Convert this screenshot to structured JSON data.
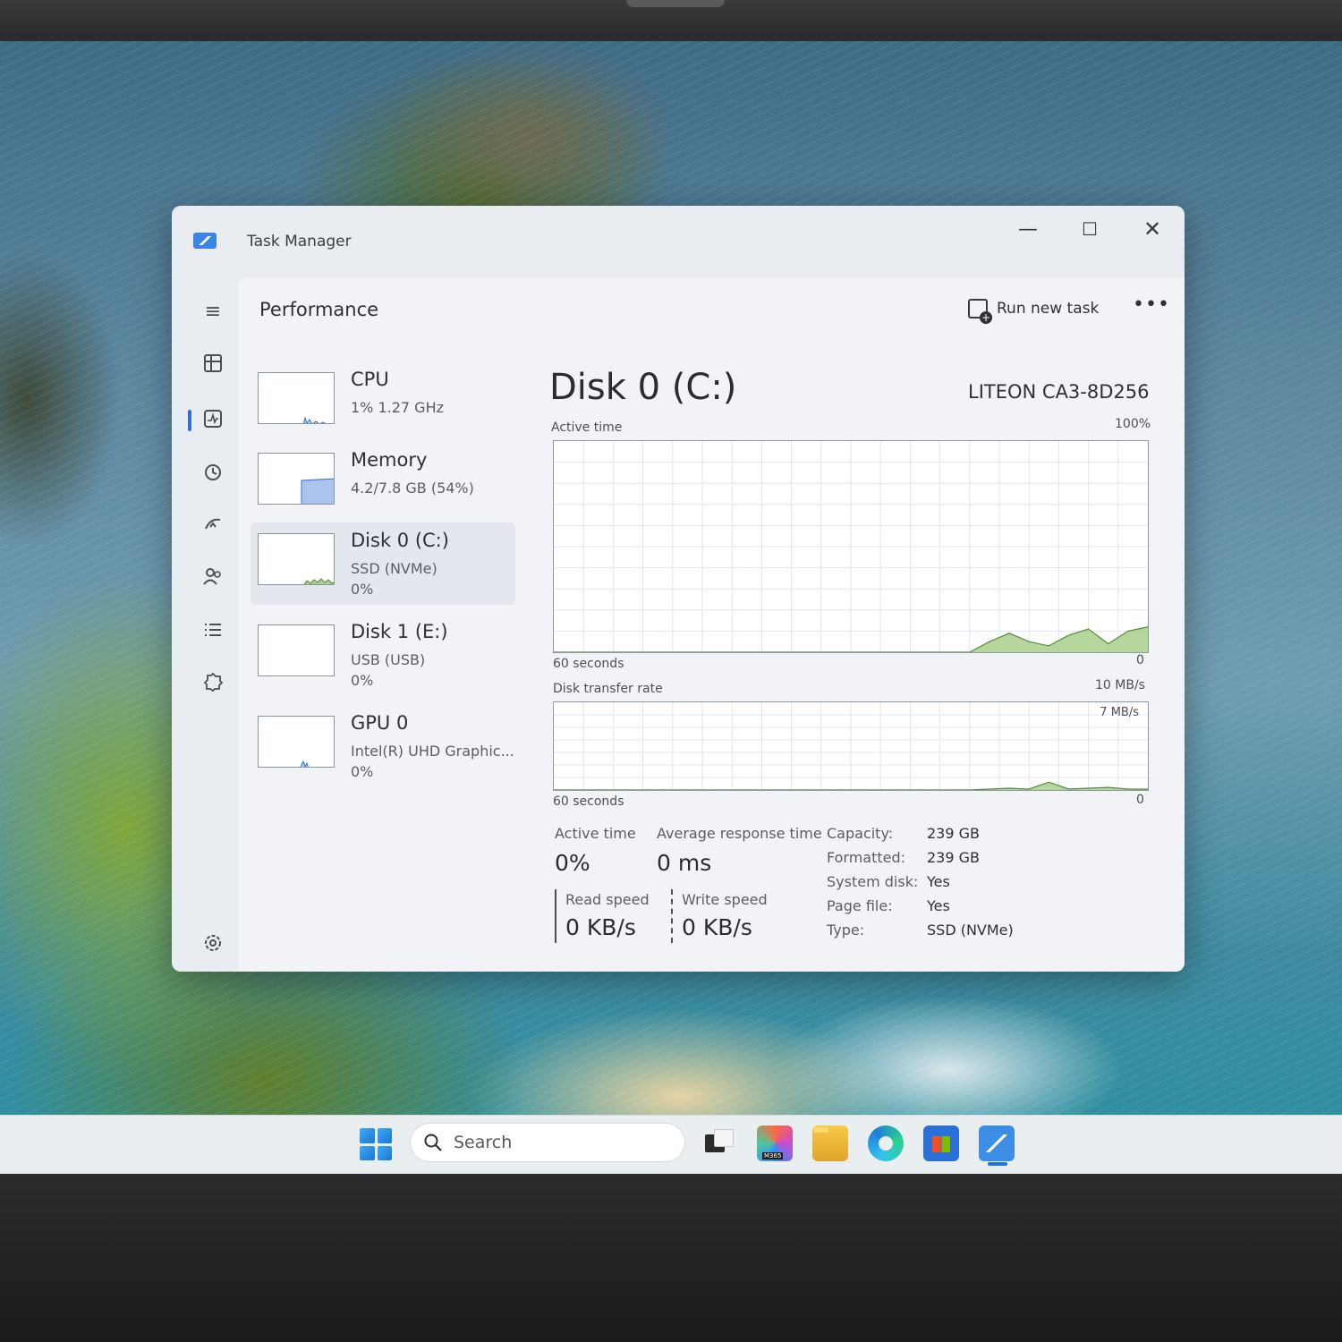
{
  "window": {
    "title": "Task Manager",
    "controls": {
      "minimize": "—",
      "maximize": "☐",
      "close": "✕"
    }
  },
  "page": {
    "title": "Performance",
    "run_new_task": "Run new task",
    "more": "•••"
  },
  "nav_icons": [
    "hamburger-icon",
    "processes-icon",
    "performance-icon",
    "app-history-icon",
    "startup-apps-icon",
    "users-icon",
    "details-icon",
    "services-icon",
    "settings-icon"
  ],
  "resources": [
    {
      "name": "CPU",
      "sub": "1% 1.27 GHz",
      "sub2": ""
    },
    {
      "name": "Memory",
      "sub": "4.2/7.8 GB (54%)",
      "sub2": ""
    },
    {
      "name": "Disk 0 (C:)",
      "sub": "SSD (NVMe)",
      "sub2": "0%"
    },
    {
      "name": "Disk 1 (E:)",
      "sub": "USB (USB)",
      "sub2": "0%"
    },
    {
      "name": "GPU 0",
      "sub": "Intel(R) UHD Graphic...",
      "sub2": "0%"
    }
  ],
  "detail": {
    "title": "Disk 0 (C:)",
    "model": "LITEON CA3-8D256",
    "active_time_graph": {
      "label": "Active time",
      "max": "100%",
      "time_span": "60 seconds",
      "min": "0"
    },
    "transfer_graph": {
      "label": "Disk transfer rate",
      "max": "10 MB/s",
      "inner_max": "7 MB/s",
      "time_span": "60 seconds",
      "min": "0"
    },
    "stats": {
      "active_time_label": "Active time",
      "active_time_value": "0%",
      "avg_response_label": "Average response time",
      "avg_response_value": "0 ms",
      "read_label": "Read speed",
      "read_value": "0 KB/s",
      "write_label": "Write speed",
      "write_value": "0 KB/s"
    },
    "properties": [
      {
        "label": "Capacity:",
        "value": "239 GB"
      },
      {
        "label": "Formatted:",
        "value": "239 GB"
      },
      {
        "label": "System disk:",
        "value": "Yes"
      },
      {
        "label": "Page file:",
        "value": "Yes"
      },
      {
        "label": "Type:",
        "value": "SSD (NVMe)"
      }
    ]
  },
  "chart_data": [
    {
      "type": "area",
      "title": "Active time",
      "ylim": [
        0,
        100
      ],
      "x": [
        60,
        58,
        56,
        54,
        52,
        50,
        48,
        46,
        44,
        42,
        40,
        38,
        36,
        34,
        32,
        30,
        28,
        26,
        24,
        22,
        20,
        18,
        16,
        14,
        12,
        10,
        8,
        6,
        4,
        2,
        0
      ],
      "series": [
        {
          "values": [
            0,
            0,
            0,
            0,
            0,
            0,
            0,
            0,
            0,
            0,
            0,
            0,
            0,
            0,
            0,
            0,
            0,
            0,
            0,
            0,
            0,
            0,
            5,
            9,
            5,
            3,
            8,
            11,
            4,
            10,
            12
          ]
        }
      ]
    },
    {
      "type": "area",
      "title": "Disk transfer rate",
      "ylim": [
        0,
        10
      ],
      "x": [
        60,
        58,
        56,
        54,
        52,
        50,
        48,
        46,
        44,
        42,
        40,
        38,
        36,
        34,
        32,
        30,
        28,
        26,
        24,
        22,
        20,
        18,
        16,
        14,
        12,
        10,
        8,
        6,
        4,
        2,
        0
      ],
      "series": [
        {
          "values": [
            0,
            0,
            0,
            0,
            0,
            0,
            0,
            0,
            0,
            0,
            0,
            0,
            0,
            0,
            0,
            0,
            0,
            0,
            0,
            0,
            0,
            0,
            0.1,
            0.2,
            0.1,
            0.9,
            0.1,
            0.2,
            0.3,
            0.1,
            0.1
          ]
        }
      ]
    }
  ],
  "taskbar": {
    "search_placeholder": "Search",
    "apps": [
      "start-icon",
      "task-view-icon",
      "microsoft-365-icon",
      "file-explorer-icon",
      "edge-icon",
      "store-icon",
      "task-manager-icon"
    ],
    "m365_badge": "M365"
  },
  "colors": {
    "accent": "#2f6fda",
    "graph_fill": "#a8d08d",
    "graph_line": "#5a8a3a",
    "memory_fill": "#aac4ee"
  }
}
